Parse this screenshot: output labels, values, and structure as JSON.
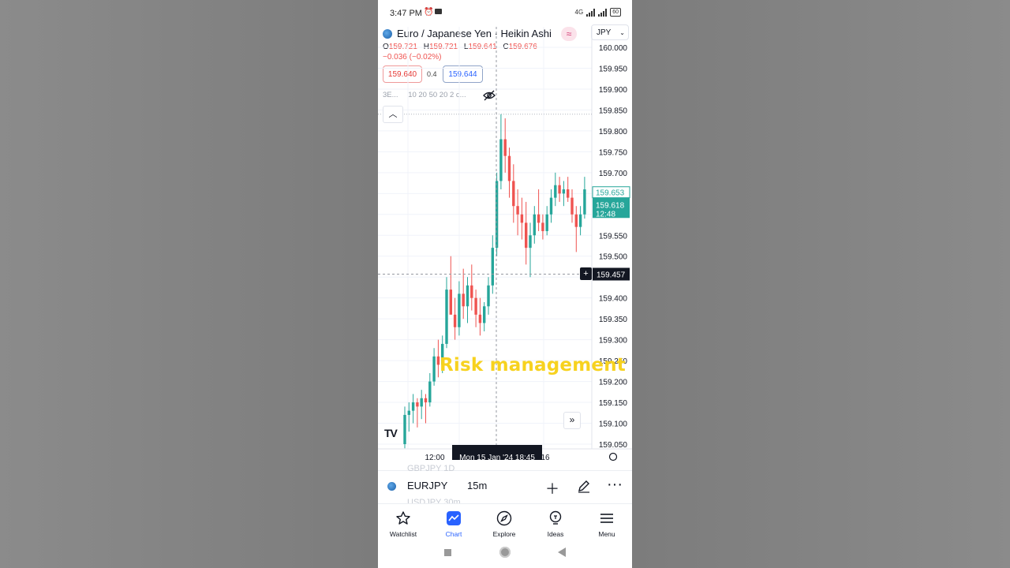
{
  "status_bar": {
    "time": "3:47 PM",
    "network": "4G",
    "battery": "60"
  },
  "symbol": {
    "title": "Euro / Japanese Yen · Heikin Ashi",
    "currency": "JPY",
    "badge_icon": "wave-icon"
  },
  "ohlc": {
    "o_label": "O",
    "o": "159.721",
    "h_label": "H",
    "h": "159.721",
    "l_label": "L",
    "l": "159.641",
    "c_label": "C",
    "c": "159.676"
  },
  "change": "−0.036 (−0.02%)",
  "trade": {
    "sell": "159.640",
    "spread": "0.4",
    "buy": "159.644"
  },
  "indicators": {
    "short": "3E...",
    "values": "10 20 50 20 2 c..."
  },
  "chart_data": {
    "type": "candlestick",
    "style": "Heikin Ashi",
    "y_ticks": [
      "160.000",
      "159.950",
      "159.900",
      "159.850",
      "159.800",
      "159.750",
      "159.700",
      "159.650",
      "159.600",
      "159.550",
      "159.500",
      "159.450",
      "159.400",
      "159.350",
      "159.300",
      "159.250",
      "159.200",
      "159.150",
      "159.100",
      "159.050"
    ],
    "ylim": [
      159.05,
      160.0
    ],
    "x_ticks": [
      "12:00",
      "16"
    ],
    "price_labels": {
      "upper": "159.653",
      "last": "159.618",
      "countdown": "12:48",
      "crosshair": "159.457"
    },
    "crosshair_time": "Mon 15 Jan '24   18:45",
    "colors": {
      "up": "#26a69a",
      "down": "#ef5350"
    },
    "candles": [
      {
        "o": 159.05,
        "h": 159.14,
        "l": 159.04,
        "c": 159.12
      },
      {
        "o": 159.12,
        "h": 159.15,
        "l": 159.08,
        "c": 159.13
      },
      {
        "o": 159.13,
        "h": 159.17,
        "l": 159.1,
        "c": 159.15
      },
      {
        "o": 159.15,
        "h": 159.16,
        "l": 159.09,
        "c": 159.14
      },
      {
        "o": 159.14,
        "h": 159.18,
        "l": 159.11,
        "c": 159.16
      },
      {
        "o": 159.16,
        "h": 159.17,
        "l": 159.1,
        "c": 159.15
      },
      {
        "o": 159.15,
        "h": 159.22,
        "l": 159.14,
        "c": 159.2
      },
      {
        "o": 159.2,
        "h": 159.28,
        "l": 159.19,
        "c": 159.26
      },
      {
        "o": 159.26,
        "h": 159.3,
        "l": 159.21,
        "c": 159.24
      },
      {
        "o": 159.24,
        "h": 159.31,
        "l": 159.22,
        "c": 159.29
      },
      {
        "o": 159.29,
        "h": 159.45,
        "l": 159.28,
        "c": 159.42
      },
      {
        "o": 159.42,
        "h": 159.5,
        "l": 159.38,
        "c": 159.36
      },
      {
        "o": 159.36,
        "h": 159.4,
        "l": 159.3,
        "c": 159.33
      },
      {
        "o": 159.33,
        "h": 159.44,
        "l": 159.31,
        "c": 159.41
      },
      {
        "o": 159.41,
        "h": 159.47,
        "l": 159.35,
        "c": 159.38
      },
      {
        "o": 159.38,
        "h": 159.45,
        "l": 159.34,
        "c": 159.43
      },
      {
        "o": 159.43,
        "h": 159.48,
        "l": 159.37,
        "c": 159.4
      },
      {
        "o": 159.4,
        "h": 159.42,
        "l": 159.33,
        "c": 159.36
      },
      {
        "o": 159.36,
        "h": 159.4,
        "l": 159.31,
        "c": 159.34
      },
      {
        "o": 159.34,
        "h": 159.39,
        "l": 159.32,
        "c": 159.38
      },
      {
        "o": 159.38,
        "h": 159.45,
        "l": 159.36,
        "c": 159.43
      },
      {
        "o": 159.43,
        "h": 159.55,
        "l": 159.41,
        "c": 159.52
      },
      {
        "o": 159.52,
        "h": 159.7,
        "l": 159.5,
        "c": 159.68
      },
      {
        "o": 159.68,
        "h": 159.84,
        "l": 159.66,
        "c": 159.78
      },
      {
        "o": 159.78,
        "h": 159.83,
        "l": 159.7,
        "c": 159.74
      },
      {
        "o": 159.74,
        "h": 159.76,
        "l": 159.64,
        "c": 159.68
      },
      {
        "o": 159.68,
        "h": 159.72,
        "l": 159.58,
        "c": 159.62
      },
      {
        "o": 159.62,
        "h": 159.66,
        "l": 159.55,
        "c": 159.6
      },
      {
        "o": 159.6,
        "h": 159.64,
        "l": 159.54,
        "c": 159.58
      },
      {
        "o": 159.58,
        "h": 159.63,
        "l": 159.48,
        "c": 159.52
      },
      {
        "o": 159.52,
        "h": 159.58,
        "l": 159.45,
        "c": 159.55
      },
      {
        "o": 159.55,
        "h": 159.62,
        "l": 159.53,
        "c": 159.6
      },
      {
        "o": 159.6,
        "h": 159.66,
        "l": 159.56,
        "c": 159.58
      },
      {
        "o": 159.58,
        "h": 159.6,
        "l": 159.54,
        "c": 159.56
      },
      {
        "o": 159.56,
        "h": 159.62,
        "l": 159.55,
        "c": 159.6
      },
      {
        "o": 159.6,
        "h": 159.66,
        "l": 159.58,
        "c": 159.64
      },
      {
        "o": 159.64,
        "h": 159.7,
        "l": 159.62,
        "c": 159.67
      },
      {
        "o": 159.67,
        "h": 159.69,
        "l": 159.63,
        "c": 159.65
      },
      {
        "o": 159.65,
        "h": 159.68,
        "l": 159.62,
        "c": 159.66
      },
      {
        "o": 159.66,
        "h": 159.69,
        "l": 159.63,
        "c": 159.64
      },
      {
        "o": 159.64,
        "h": 159.66,
        "l": 159.58,
        "c": 159.6
      },
      {
        "o": 159.6,
        "h": 159.62,
        "l": 159.51,
        "c": 159.57
      },
      {
        "o": 159.57,
        "h": 159.62,
        "l": 159.55,
        "c": 159.6
      },
      {
        "o": 159.6,
        "h": 159.69,
        "l": 159.59,
        "c": 159.66
      }
    ]
  },
  "overlay_text": "Risk management",
  "toolbar": {
    "symbol": "EURJPY",
    "timeframe": "15m",
    "ghost_above": "GBPJPY    1D",
    "ghost_below": "USDJPY    30m"
  },
  "nav": [
    {
      "label": "Watchlist",
      "icon": "star-icon"
    },
    {
      "label": "Chart",
      "icon": "chart-icon"
    },
    {
      "label": "Explore",
      "icon": "compass-icon"
    },
    {
      "label": "Ideas",
      "icon": "lightbulb-icon"
    },
    {
      "label": "Menu",
      "icon": "hamburger-icon"
    }
  ]
}
